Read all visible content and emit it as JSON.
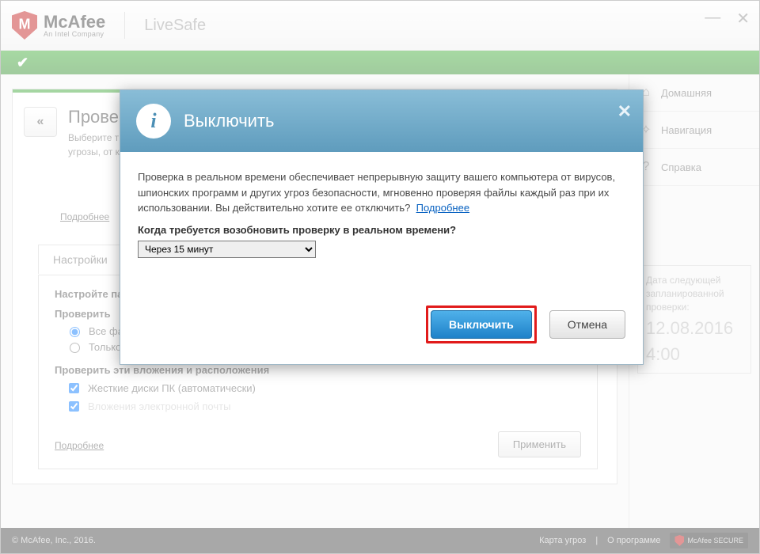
{
  "brand": {
    "name": "McAfee",
    "sub": "An Intel Company",
    "product": "LiveSafe"
  },
  "sidebar": {
    "items": [
      {
        "label": "Домашняя"
      },
      {
        "label": "Навигация"
      },
      {
        "label": "Справка"
      }
    ],
    "next_scan": {
      "caption": "Дата следующей запланированной проверки:",
      "date": "12.08.2016",
      "time": "4:00"
    }
  },
  "panel": {
    "title": "Проверка",
    "subtitle": "Выберите типы файлов, которые будут проверяться во время запланированной проверки, а также укажите угрозы, от которых нужна защита.",
    "more": "Подробнее",
    "tab": "Настройки",
    "configure": "Настройте параметры проверки.",
    "group1": {
      "heading": "Проверить",
      "opt1": "Все файлы (рекомендуется)",
      "opt2": "Только программы и документы"
    },
    "group2": {
      "heading": "Проверить эти вложения и расположения",
      "opt1": "Жесткие диски ПК (автоматически)",
      "opt2": "Вложения электронной почты"
    },
    "apply": "Применить",
    "more2": "Подробнее"
  },
  "dialog": {
    "title": "Выключить",
    "body": "Проверка в реальном времени обеспечивает непрерывную защиту вашего компьютера от вирусов, шпионских программ и других угроз безопасности, мгновенно проверяя файлы каждый раз при их использовании. Вы действительно хотите ее отключить?",
    "body_link": "Подробнее",
    "question": "Когда требуется возобновить проверку в реальном времени?",
    "select_value": "Через 15 минут",
    "primary": "Выключить",
    "cancel": "Отмена"
  },
  "footer": {
    "copyright": "© McAfee, Inc., 2016.",
    "link1": "Карта угроз",
    "link2": "О программе",
    "badge": "McAfee SECURE"
  }
}
